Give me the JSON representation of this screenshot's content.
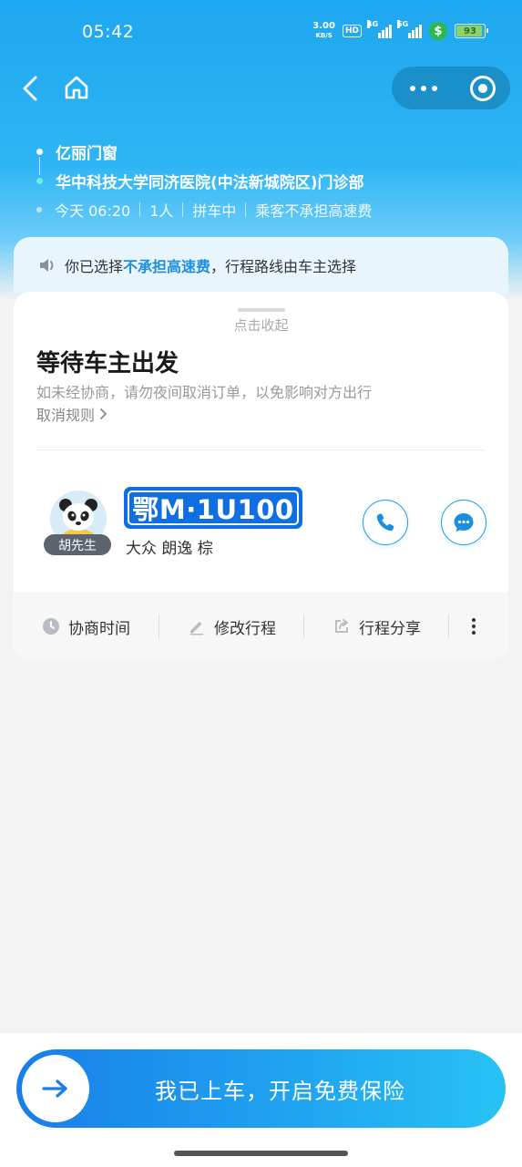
{
  "status_bar": {
    "time": "05:42",
    "net_speed_value": "3.00",
    "net_speed_unit": "KB/S",
    "hd": "HD",
    "sig1_label": "4G",
    "sig2_label": "5G",
    "money_symbol": "$",
    "battery": "93"
  },
  "route": {
    "origin": "亿丽门窗",
    "destination": "华中科技大学同济医院(中法新城院区)门诊部",
    "time": "今天 06:20",
    "passengers": "1人",
    "status": "拼车中",
    "toll_note": "乘客不承担高速费"
  },
  "notice": {
    "prefix": "你已选择",
    "highlight": "不承担高速费",
    "suffix": "，行程路线由车主选择"
  },
  "card": {
    "collapse_label": "点击收起",
    "title": "等待车主出发",
    "subtitle": "如未经协商，请勿夜间取消订单，以免影响对方出行",
    "cancel_rule": "取消规则"
  },
  "driver": {
    "name": "胡先生",
    "plate": "鄂M·1U100",
    "car_model": "大众 朗逸 棕"
  },
  "actions": [
    {
      "label": "协商时间",
      "icon": "clock-icon"
    },
    {
      "label": "修改行程",
      "icon": "edit-icon"
    },
    {
      "label": "行程分享",
      "icon": "share-icon"
    }
  ],
  "cta": {
    "label": "我已上车，开启免费保险"
  },
  "colors": {
    "accent": "#1d8fe0",
    "header": "#1ea7f0",
    "plate": "#0f6fe0",
    "cta_start": "#1a7ee8",
    "cta_end": "#28c2f5"
  }
}
